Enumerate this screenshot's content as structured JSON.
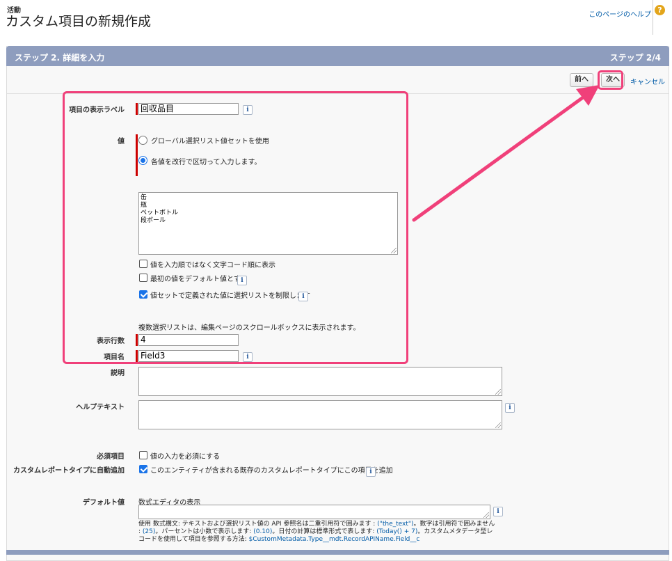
{
  "header": {
    "eyebrow": "活動",
    "title": "カスタム項目の新規作成",
    "help_link": "このページのヘルプ",
    "help_icon": "question-icon"
  },
  "step_bar": {
    "title": "ステップ 2. 詳細を入力",
    "step": "ステップ 2/4"
  },
  "buttons": {
    "prev": "前へ",
    "next": "次へ",
    "cancel": "キャンセル"
  },
  "form": {
    "field_label": {
      "label": "項目の表示ラベル",
      "value": "回収品目"
    },
    "values": {
      "label": "値",
      "option_global": "グローバル選択リスト値セットを使用",
      "option_each": "各値を改行で区切って入力します。",
      "selected": "each",
      "entries": [
        "缶",
        "瓶",
        "ペットボトル",
        "段ボール"
      ]
    },
    "checkboxes": {
      "sort_alpha": {
        "label": "値を入力順ではなく文字コード順に表示",
        "checked": false
      },
      "first_default": {
        "label": "最初の値をデフォルト値とする",
        "checked": false
      },
      "restrict": {
        "label": "値セットで定義された値に選択リストを制限します",
        "checked": true
      }
    },
    "multi_note": "複数選択リストは、編集ページのスクロールボックスに表示されます。",
    "visible_lines": {
      "label": "表示行数",
      "value": "4"
    },
    "field_name": {
      "label": "項目名",
      "value": "Field3"
    },
    "description": {
      "label": "説明",
      "value": ""
    },
    "help_text": {
      "label": "ヘルプテキスト",
      "value": ""
    },
    "required": {
      "label": "必須項目",
      "checkbox_label": "値の入力を必須にする",
      "checked": false
    },
    "auto_add": {
      "label": "カスタムレポートタイプに自動追加",
      "checkbox_label": "このエンティティが含まれる既存のカスタムレポートタイプにこの項目を追加",
      "checked": true
    },
    "default_value": {
      "label": "デフォルト値",
      "link": "数式エディタの表示",
      "value": "",
      "note_a": "使用 数式構文: テキストおよび選択リスト値の API 参照名は二重引用符で囲みます : ",
      "note_b": "(\"the_text\")",
      "note_c": "。数字は引用符で囲みません : ",
      "note_d": "(25)",
      "note_e": "。パーセントは小数で表示します: ",
      "note_f": "(0.10)",
      "note_g": "。日付の計算は標準形式で表します: ",
      "note_h": "(Today() + 7)",
      "note_i": "。カスタムメタデータ型レコードを使用して項目を参照する方法: ",
      "note_j": "$CustomMetadata.Type__mdt.RecordAPIName.Field__c"
    }
  },
  "colors": {
    "step_bar": "#8e9dbe",
    "highlight": "#f0407a",
    "required": "#cc0000",
    "link": "#015ba7"
  }
}
